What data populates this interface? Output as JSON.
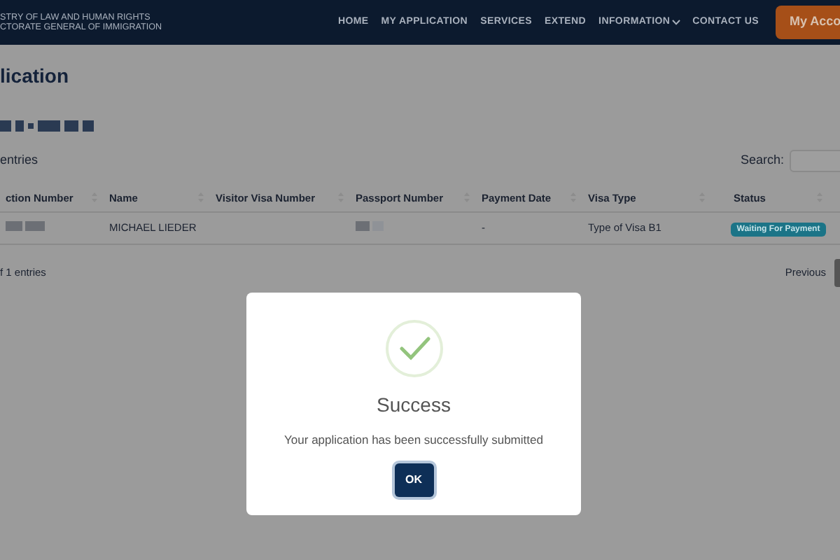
{
  "header": {
    "org_lines": [
      "STRY OF  LAW  AND HUMAN RIGHTS",
      "CTORATE GENERAL OF IMMIGRATION"
    ],
    "nav": [
      {
        "label": "HOME",
        "dropdown": false
      },
      {
        "label": "MY APPLICATION",
        "dropdown": false
      },
      {
        "label": "SERVICES",
        "dropdown": false
      },
      {
        "label": "EXTEND",
        "dropdown": false
      },
      {
        "label": "INFORMATION",
        "dropdown": true
      },
      {
        "label": "CONTACT US",
        "dropdown": false
      }
    ],
    "account_button": "My Acco"
  },
  "page": {
    "title": "lication",
    "length_text": "entries",
    "search_label": "Search:",
    "table": {
      "columns": [
        "ction Number",
        "Name",
        "Visitor Visa Number",
        "Passport Number",
        "Payment Date",
        "Visa Type",
        "Status"
      ],
      "rows": [
        {
          "cells": [
            {
              "kind": "redacted"
            },
            {
              "kind": "text",
              "text": "MICHAEL LIEDER"
            },
            {
              "kind": "empty"
            },
            {
              "kind": "redacted"
            },
            {
              "kind": "text",
              "text": "-"
            },
            {
              "kind": "text",
              "text": "Type of Visa B1"
            },
            {
              "kind": "badge",
              "text": "Waiting For Payment"
            }
          ]
        }
      ]
    },
    "info": "f 1 entries",
    "pagination": [
      "Previous"
    ]
  },
  "modal": {
    "title": "Success",
    "message": "Your application has been successfully submitted",
    "button": "OK"
  }
}
